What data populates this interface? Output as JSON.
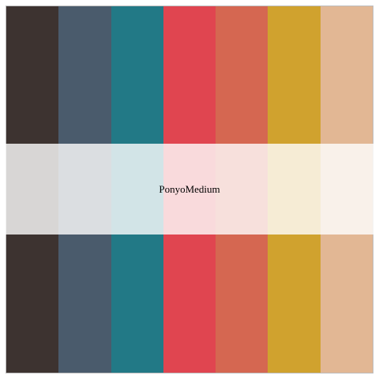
{
  "palette": {
    "name": "PonyoMedium",
    "colors": [
      "#3D3330",
      "#4A5B6C",
      "#227986",
      "#E04550",
      "#D56751",
      "#D0A22E",
      "#E2B794"
    ]
  }
}
